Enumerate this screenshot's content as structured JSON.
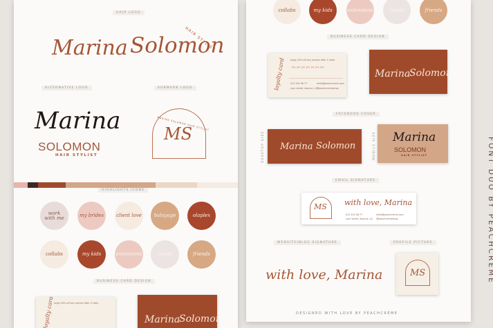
{
  "brand": {
    "first": "Marina",
    "last": "Solomon",
    "upper": "SOLOMON",
    "tagline": "HAIR STYLIST",
    "arch_text": "MARINA SOLOMON HAIR STYLIST",
    "monogram": "MS",
    "signature": "with love, Marina"
  },
  "labels": {
    "hair_logo": "HAIR LOGO",
    "alternative_logo": "ALTERNATIVE LOGO",
    "submark_logo": "SUBMARK LOGO",
    "highlights_icons": "HIGHLIGHTS ICONS",
    "business_card": "BUSINESS CARD DESIGN",
    "facebook_cover": "FACEBOOK COVER",
    "desktop_size": "DESKTOP SIZE",
    "mobile_size": "MOBILE SIZE",
    "email_signature": "EMAIL SIGNATURE",
    "website_signature": "WEBSITE/BLOG SIGNATURE",
    "profile_picture": "PROFILE PICTURE",
    "footer": "DESIGNED WITH LOVE BY PEACHCREME",
    "side_text": "FONT DUO BY PEACHCREME"
  },
  "palette": [
    "#e8b4ad",
    "#3a2a26",
    "#a04a2c",
    "#d3a688",
    "#ecd7c4",
    "#f4ece3"
  ],
  "highlights_row1": [
    {
      "text": "work with me",
      "bg": "#e7dcda",
      "fg": "#8a5a4c"
    },
    {
      "text": "my brides",
      "bg": "#eccac2",
      "fg": "#a2553c"
    },
    {
      "text": "client love",
      "bg": "#f5ebe1",
      "fg": "#a2553c"
    },
    {
      "text": "balayage",
      "bg": "#d7a884",
      "fg": "#fbf4ee"
    },
    {
      "text": "olaplex",
      "bg": "#a8472b",
      "fg": "#fbf4ee"
    }
  ],
  "highlights_row2": [
    {
      "text": "collabs",
      "bg": "#f5ebe1",
      "fg": "#a2553c"
    },
    {
      "text": "my kids",
      "bg": "#a8472b",
      "fg": "#fbf4ee"
    },
    {
      "text": "extensions",
      "bg": "#eccac2",
      "fg": "#fbf4ee"
    },
    {
      "text": "travel",
      "bg": "#ebe4e3",
      "fg": "#fbf4ee"
    },
    {
      "text": "friends",
      "bg": "#d7a884",
      "fg": "#fbf4ee"
    }
  ],
  "highlights_top": [
    {
      "text": "collabs",
      "bg": "#f5ebe1",
      "fg": "#a2553c"
    },
    {
      "text": "my kids",
      "bg": "#a8472b",
      "fg": "#fbf4ee"
    },
    {
      "text": "extensions",
      "bg": "#eccac2",
      "fg": "#fbf4ee"
    },
    {
      "text": "travel",
      "bg": "#ebe4e3",
      "fg": "#fbf4ee"
    },
    {
      "text": "friends",
      "bg": "#d7a884",
      "fg": "#fbf4ee"
    }
  ],
  "loyalty": {
    "title": "loyalty card",
    "offer": "enjoy 20% off any service after 5 visits"
  },
  "contact": {
    "phone": "012 424 96 77",
    "email": "hello@peachcreme.com",
    "address": "your street, Avenue, LA",
    "handle": "@peachcremeshop"
  }
}
